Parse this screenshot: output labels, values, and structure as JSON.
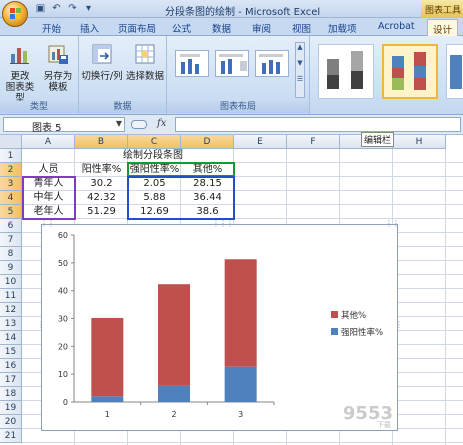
{
  "window": {
    "title": "分段条图的绘制 - Microsoft Excel",
    "context_tab_title": "图表工具"
  },
  "tabs": [
    "开始",
    "插入",
    "页面布局",
    "公式",
    "数据",
    "审阅",
    "视图",
    "加载项",
    "Acrobat",
    "设计"
  ],
  "active_tab": "设计",
  "ribbon": {
    "type_group": {
      "label": "类型",
      "change_type": "更改\n图表类型",
      "save_template": "另存为\n模板"
    },
    "data_group": {
      "label": "数据",
      "switch_row_col": "切换行/列",
      "select_data": "选择数据"
    },
    "layout_group": {
      "label": "图表布局"
    }
  },
  "formula_bar": {
    "name_box": "图表 5",
    "fx": "fx",
    "value": "",
    "tooltip": "编辑栏"
  },
  "columns": [
    "A",
    "B",
    "C",
    "D",
    "E",
    "F",
    "G",
    "H"
  ],
  "rows": [
    "1",
    "2",
    "3",
    "4",
    "5",
    "6",
    "7",
    "8",
    "9",
    "10",
    "11",
    "12",
    "13",
    "14",
    "15",
    "16",
    "17",
    "18",
    "19",
    "20",
    "21"
  ],
  "sheet": {
    "title": "绘制分段条图",
    "headers": [
      "人员",
      "阳性率%",
      "强阳性率%",
      "其他%"
    ],
    "data": [
      [
        "青年人",
        "30.2",
        "2.05",
        "28.15"
      ],
      [
        "中年人",
        "42.32",
        "5.88",
        "36.44"
      ],
      [
        "老年人",
        "51.29",
        "12.69",
        "38.6"
      ]
    ]
  },
  "colors": {
    "series_other": "#c0504d",
    "series_strong": "#4f81bd",
    "range_green": "#0e9d2e",
    "range_purple": "#7d3fb8",
    "range_blue": "#1f4fcf"
  },
  "chart_data": {
    "type": "bar",
    "stacked": true,
    "categories": [
      "1",
      "2",
      "3"
    ],
    "series": [
      {
        "name": "强阳性率%",
        "values": [
          2.05,
          5.88,
          12.69
        ]
      },
      {
        "name": "其他%",
        "values": [
          28.15,
          36.44,
          38.6
        ]
      }
    ],
    "ylim": [
      0,
      60
    ],
    "yticks": [
      0,
      10,
      20,
      30,
      40,
      50,
      60
    ],
    "legend": "right",
    "grid": false
  },
  "watermark": {
    "main": "9553",
    "sub": "下载"
  }
}
